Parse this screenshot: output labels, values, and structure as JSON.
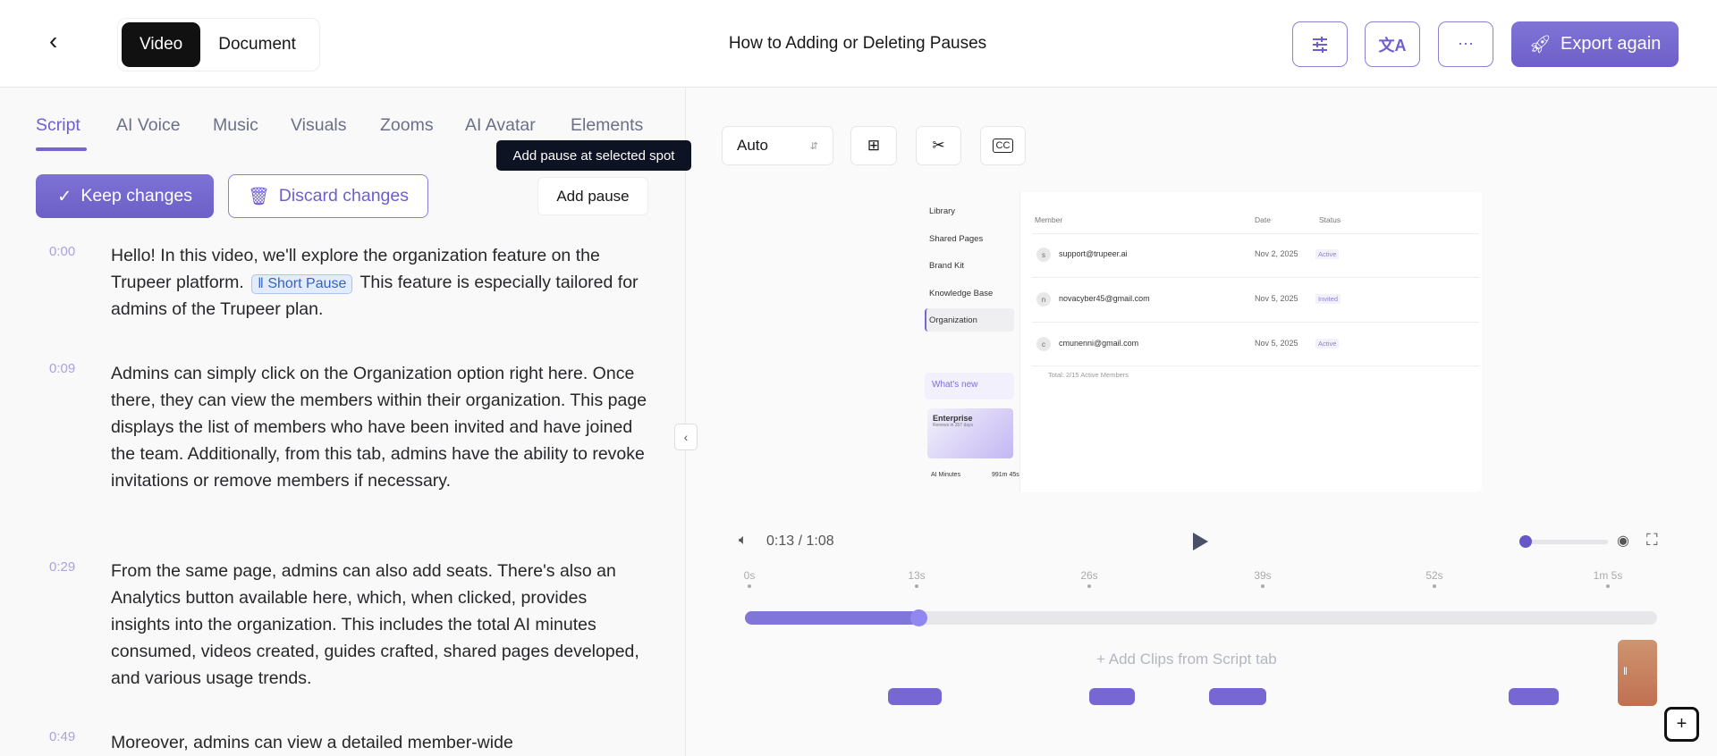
{
  "header": {
    "mode_tabs": [
      "Video",
      "Document"
    ],
    "title": "How to Adding or Deleting Pauses",
    "export_label": "Export again"
  },
  "tabs": [
    "Script",
    "AI Voice",
    "Music",
    "Visuals",
    "Zooms",
    "AI Avatar",
    "Elements"
  ],
  "tooltip": "Add pause at selected spot",
  "actions": {
    "keep": "Keep changes",
    "discard": "Discard changes",
    "add_pause": "Add pause"
  },
  "script": [
    {
      "time": "0:00",
      "before": "Hello! In this video, we'll explore the organization feature on the Trupeer platform.",
      "chip": "Short Pause",
      "after": "This feature is especially tailored for admins of the Trupeer plan."
    },
    {
      "time": "0:09",
      "text": "Admins can simply click on the Organization option right here. Once there, they can view the members within their organization. This page displays the list of members who have been invited and have joined the team. Additionally, from this tab, admins have the ability to revoke invitations or remove members if necessary."
    },
    {
      "time": "0:29",
      "text": "From the same page, admins can also add seats. There's also an Analytics button available here, which, when clicked, provides insights into the organization. This includes the total AI minutes consumed, videos created, guides crafted, shared pages developed, and various usage trends."
    },
    {
      "time": "0:49",
      "text": "Moreover, admins can view a detailed member-wide"
    }
  ],
  "toolbar": {
    "aspect": "Auto",
    "cc": "CC"
  },
  "preview": {
    "sidebar": [
      "Library",
      "Shared Pages",
      "Brand Kit",
      "Knowledge Base",
      "Organization"
    ],
    "whats_new": "What's new",
    "plan": "Enterprise",
    "renews": "Renews in 357 days",
    "ai_minutes_label": "AI Minutes",
    "ai_minutes_value": "991m 45s",
    "columns": [
      "Member",
      "Date",
      "Status"
    ],
    "rows": [
      {
        "initial": "s",
        "email": "support@trupeer.ai",
        "date": "Nov 2, 2025",
        "status": "Active"
      },
      {
        "initial": "n",
        "email": "novacyber45@gmail.com",
        "date": "Nov 5, 2025",
        "status": "Invited"
      },
      {
        "initial": "c",
        "email": "cmunenni@gmail.com",
        "date": "Nov 5, 2025",
        "status": "Active"
      }
    ],
    "total": "Total: 2/15 Active Members"
  },
  "player": {
    "current": "0:13",
    "total": "1:08",
    "time_sep": " / ",
    "progress": 0.19,
    "ruler": [
      "0s",
      "13s",
      "26s",
      "39s",
      "52s",
      "1m 5s"
    ],
    "add_clips": "Add Clips from Script tab"
  }
}
